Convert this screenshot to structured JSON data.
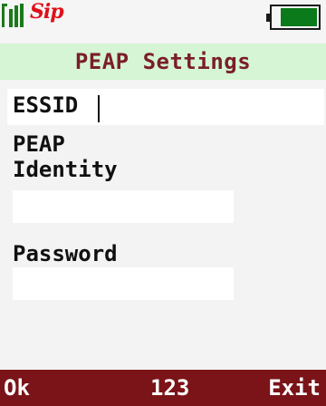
{
  "status": {
    "sip_label": "Sip",
    "signal_icon": "signal-strength-icon",
    "battery_icon": "battery-icon",
    "battery_level": 0.8
  },
  "title": "PEAP Settings",
  "form": {
    "essid_label": "ESSID",
    "essid_value": "",
    "peap_label_line1": "PEAP",
    "peap_label_line2": "Identity",
    "identity_value": "",
    "password_label": "Password",
    "password_value": ""
  },
  "softkeys": {
    "left": "Ok",
    "middle": "123",
    "right": "Exit"
  },
  "colors": {
    "title_bg": "#d5f5d5",
    "title_text": "#7a1e28",
    "softkey_bg": "#7a1418",
    "sip_red": "#e0101a",
    "battery_green": "#0b7a1a"
  }
}
